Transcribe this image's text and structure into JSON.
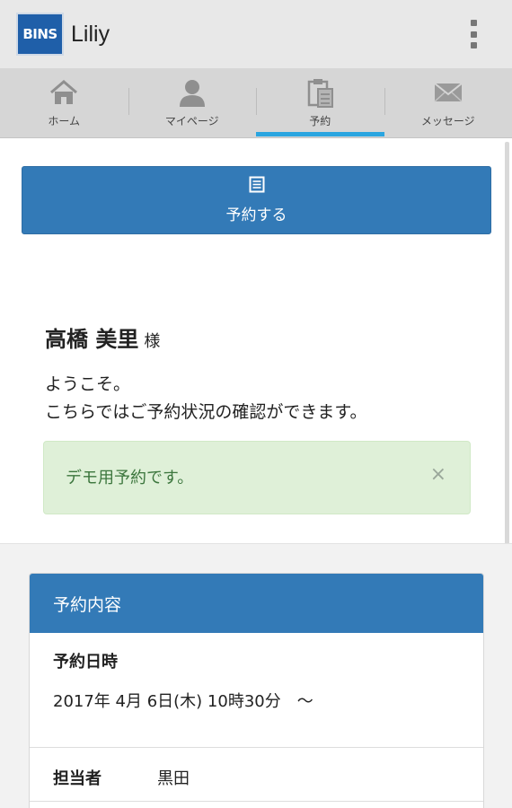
{
  "header": {
    "logo_text": "BINS",
    "app_title": "Liliy"
  },
  "tabs": [
    {
      "label": "ホーム",
      "icon": "home-icon"
    },
    {
      "label": "マイページ",
      "icon": "person-icon"
    },
    {
      "label": "予約",
      "icon": "clipboard-icon",
      "active": true
    },
    {
      "label": "メッセージ",
      "icon": "envelope-icon"
    }
  ],
  "reserve_button": {
    "label": "予約する",
    "icon": "list-icon"
  },
  "user": {
    "name": "高橋 美里",
    "honorific": "様"
  },
  "welcome": {
    "line1": "ようこそ。",
    "line2": "こちらではご予約状況の確認ができます。"
  },
  "alert": {
    "message": "デモ用予約です。",
    "close": "×"
  },
  "reservation": {
    "title": "予約内容",
    "datetime_label": "予約日時",
    "datetime_value": "2017年 4月 6日(木) 10時30分　～",
    "staff_label": "担当者",
    "staff_value": "黒田"
  },
  "colors": {
    "primary": "#337ab7",
    "tab_indicator": "#2aa5e0",
    "alert_bg": "#dff0d8",
    "alert_text": "#3c763d"
  }
}
